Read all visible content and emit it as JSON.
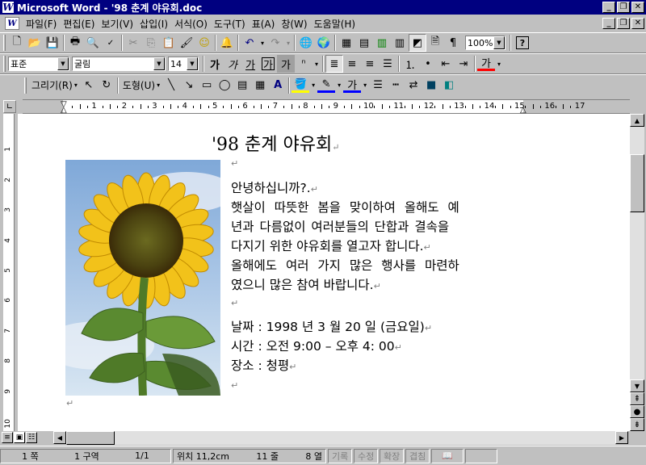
{
  "window": {
    "app_icon": "W",
    "title": "Microsoft Word - '98 춘계 야유회.doc"
  },
  "menu": {
    "items": [
      "파일(F)",
      "편집(E)",
      "보기(V)",
      "삽입(I)",
      "서식(O)",
      "도구(T)",
      "표(A)",
      "창(W)",
      "도움말(H)"
    ]
  },
  "toolbar_standard": {
    "zoom": "100%",
    "help_label": "?"
  },
  "toolbar_format": {
    "style": "표준",
    "font": "굴림",
    "size": "14",
    "bold": "가",
    "italic": "가",
    "underline": "가",
    "box": "가",
    "shade": "가",
    "font_color": "가"
  },
  "toolbar_drawing": {
    "draw_label": "그리기(R)",
    "autoshape_label": "도형(U)",
    "text_color": "가"
  },
  "ruler": {
    "numbers": [
      "1",
      "2",
      "3",
      "4",
      "5",
      "6",
      "7",
      "8",
      "9",
      "10",
      "11",
      "12",
      "13",
      "14",
      "15",
      "16",
      "17"
    ],
    "v_numbers": [
      "1",
      "2",
      "3",
      "4",
      "5",
      "6",
      "7",
      "8",
      "9",
      "10"
    ]
  },
  "document": {
    "title": "'98 춘계 야유회",
    "para_mark": "↵",
    "greeting": "안녕하십니까?.",
    "lines": [
      "햇살이 따뜻한 봄을 맞이하여 올해도 예",
      "년과 다름없이 여러분들의 단합과 결속을",
      "다지기 위한 야유회를 열고자 합니다.",
      "올해에도 여러 가지 많은 행사를 마련하",
      "였으니 많은 참여 바랍니다."
    ],
    "date_line": "날짜 : 1998 년  3 월  20 일  (금요일)",
    "time_line": "시간 : 오전  9:00 –  오후  4: 00",
    "place_line": "장소 : 청평"
  },
  "status": {
    "page": "1 쪽",
    "section": "1 구역",
    "pages": "1/1",
    "position": "위치 11,2cm",
    "line": "11 줄",
    "col": "8 열",
    "rec": "기록",
    "trk": "수정",
    "ext": "확장",
    "ovr": "겹침"
  },
  "colors": {
    "title_bar": "#000080",
    "chrome": "#c0c0c0",
    "page": "#ffffff"
  }
}
